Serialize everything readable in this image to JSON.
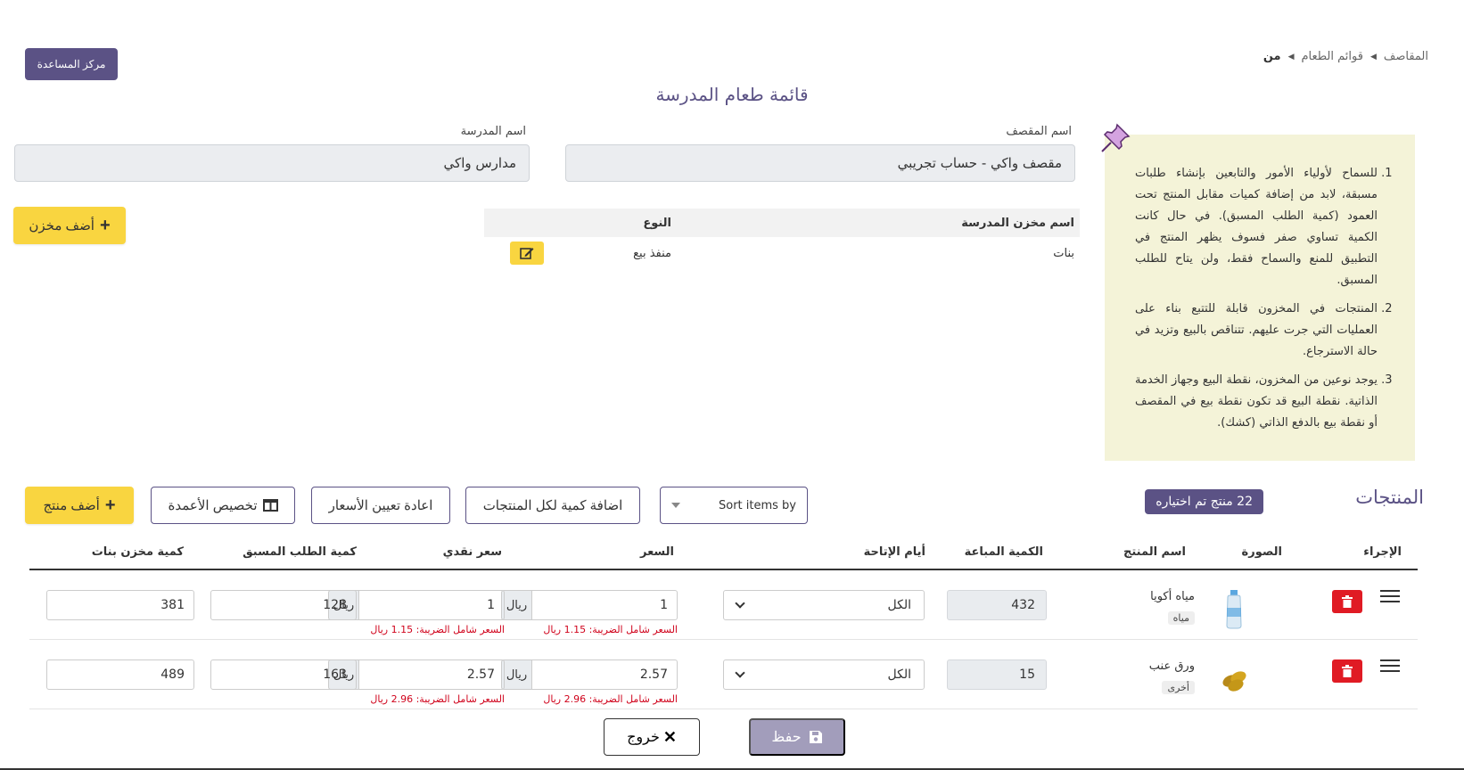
{
  "header": {
    "help_center": "مركز المساعدة",
    "breadcrumb": [
      "المقاصف",
      "قوائم الطعام",
      "من"
    ],
    "page_title": "قائمة طعام المدرسة"
  },
  "form": {
    "canteen_label": "اسم المقصف",
    "canteen_value": "مقصف واكي - حساب تجريبي",
    "school_label": "اسم المدرسة",
    "school_value": "مدارس واكي"
  },
  "add_warehouse": "أضف مخزن",
  "warehouse_table": {
    "headers": [
      "اسم مخزن المدرسة",
      "النوع"
    ],
    "rows": [
      {
        "name": "بنات",
        "type": "منفذ بيع"
      }
    ]
  },
  "info": {
    "items": [
      "للسماح لأولياء الأمور والتابعين بإنشاء طلبات مسبقة، لابد من إضافة كميات مقابل المنتج تحت العمود (كمية الطلب المسبق). في حال كانت الكمية تساوي صفر فسوف يظهر المنتج في التطبيق للمنع والسماح فقط، ولن يتاح للطلب المسبق.",
      "المنتجات في المخزون قابلة للتتبع بناء على العمليات التي جرت عليهم. تتناقص بالبيع وتزيد في حالة الاسترجاع.",
      "يوجد نوعين من المخزون، نقطة البيع وجهاز الخدمة الذاتية. نقطة البيع قد تكون نقطة بيع في المقصف أو نقطة بيع بالدفع الذاتي (كشك)."
    ]
  },
  "products": {
    "title": "المنتجات",
    "selected_badge": "22 منتج تم اختياره",
    "sort_placeholder": "Sort items by",
    "add_qty_all": "اضافة كمية لكل المنتجات",
    "reset_prices": "اعادة تعيين الأسعار",
    "customize_columns": "تخصيص الأعمدة",
    "add_product": "أضف منتج",
    "headers": {
      "action": "الإجراء",
      "image": "الصورة",
      "name": "اسم المنتج",
      "qty_sold": "الكمية المباعة",
      "days": "أيام الإتاحة",
      "price": "السعر",
      "cash_price": "سعر نقدي",
      "preorder_qty": "كمية الطلب المسبق",
      "warehouse_qty": "كمية مخزن بنات"
    },
    "rows": [
      {
        "name": "مياه أكويا",
        "category": "مياه",
        "qty_sold": "432",
        "days": "الكل",
        "price": "1",
        "currency": "ريال",
        "price_tax": "السعر شامل الضريبة: 1.15 ريال",
        "cash_price": "1",
        "cash_tax": "السعر شامل الضريبة: 1.15 ريال",
        "preorder_qty": "128",
        "warehouse_qty": "381"
      },
      {
        "name": "ورق عنب",
        "category": "أخرى",
        "qty_sold": "15",
        "days": "الكل",
        "price": "2.57",
        "currency": "ريال",
        "price_tax": "السعر شامل الضريبة: 2.96 ريال",
        "cash_price": "2.57",
        "cash_tax": "السعر شامل الضريبة: 2.96 ريال",
        "preorder_qty": "163",
        "warehouse_qty": "489"
      }
    ]
  },
  "footer": {
    "save": "حفظ",
    "exit": "خروج"
  },
  "colors": {
    "primary": "#5b5285",
    "accent_yellow": "#f9d540",
    "danger": "#e01b24",
    "info_bg": "#f4f3d8"
  }
}
